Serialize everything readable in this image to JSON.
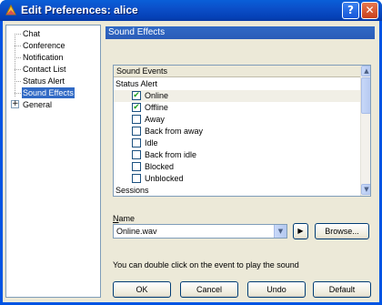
{
  "window": {
    "title": "Edit Preferences: alice",
    "help_button": "?",
    "close_button": "✕"
  },
  "sidebar": {
    "items": [
      {
        "label": "Chat"
      },
      {
        "label": "Conference"
      },
      {
        "label": "Notification"
      },
      {
        "label": "Contact List"
      },
      {
        "label": "Status Alert"
      },
      {
        "label": "Sound Effects",
        "selected": true
      },
      {
        "label": "General",
        "expandable": true
      }
    ],
    "expander_symbol": "+"
  },
  "panel": {
    "title": "Sound Effects"
  },
  "events": {
    "header": "Sound Events",
    "group_status_alert": "Status Alert",
    "items": [
      {
        "label": "Online",
        "checked": true,
        "checkmark": "✔"
      },
      {
        "label": "Offline",
        "checked": true,
        "checkmark": "✔"
      },
      {
        "label": "Away",
        "checked": false,
        "checkmark": ""
      },
      {
        "label": "Back from away",
        "checked": false,
        "checkmark": ""
      },
      {
        "label": "Idle",
        "checked": false,
        "checkmark": ""
      },
      {
        "label": "Back from idle",
        "checked": false,
        "checkmark": ""
      },
      {
        "label": "Blocked",
        "checked": false,
        "checkmark": ""
      },
      {
        "label": "Unblocked",
        "checked": false,
        "checkmark": ""
      }
    ],
    "group_sessions": "Sessions",
    "scroll_up": "▲",
    "scroll_down": "▼"
  },
  "name_field": {
    "label_first": "N",
    "label_rest": "ame",
    "value": "Online.wav",
    "dropdown_arrow": "▼"
  },
  "buttons": {
    "play": "▶",
    "browse": "Browse...",
    "ok": "OK",
    "cancel": "Cancel",
    "undo": "Undo",
    "default": "Default"
  },
  "hint_text": "You can double click on the event to play the sound"
}
